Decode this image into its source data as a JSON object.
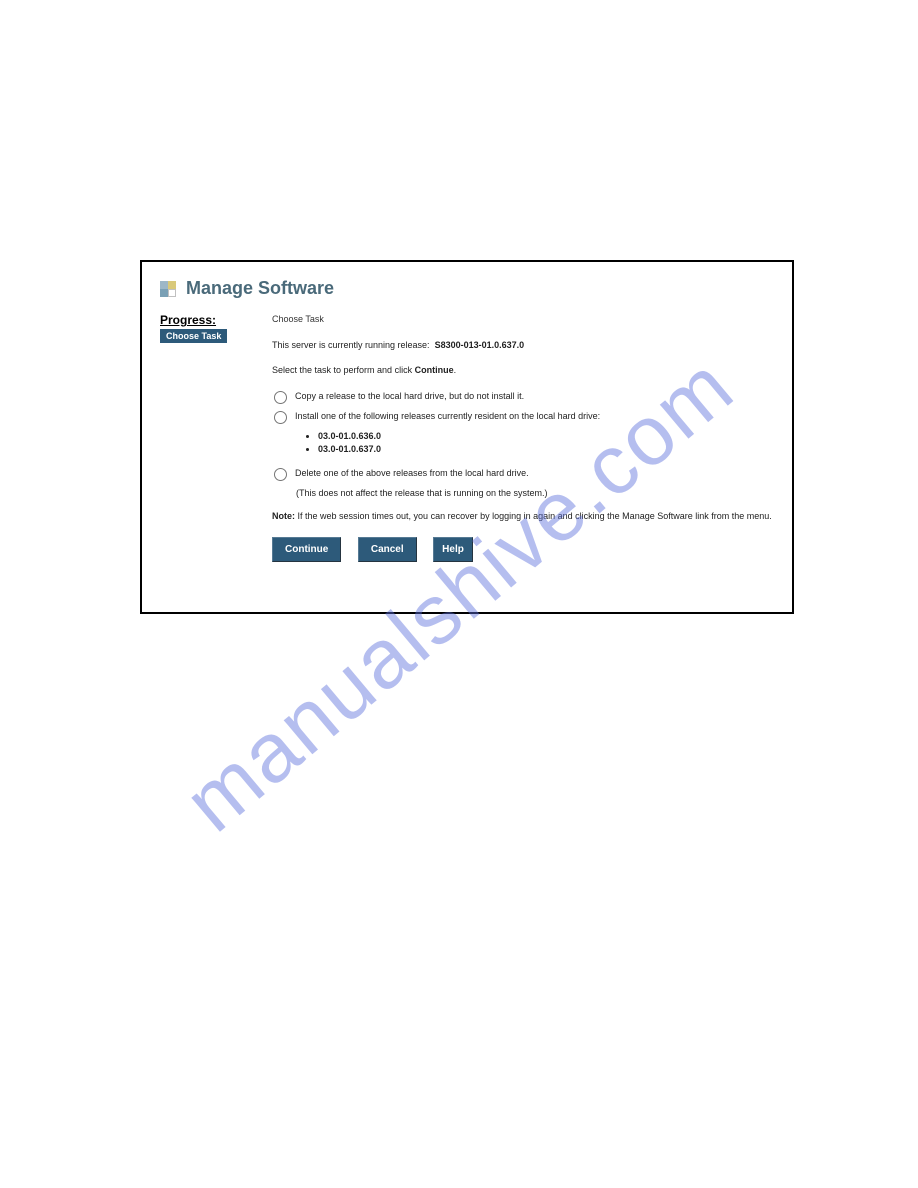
{
  "watermark": "manualshive.com",
  "header": {
    "title": "Manage Software"
  },
  "progress": {
    "label": "Progress:",
    "step": "Choose Task"
  },
  "main": {
    "step_title": "Choose Task",
    "running_prefix": "This server is currently running release:",
    "running_release": "S8300-013-01.0.637.0",
    "select_prefix": "Select the task to perform and click ",
    "select_bold": "Continue",
    "select_suffix": ".",
    "options": {
      "copy": "Copy a release to the local hard drive, but do not install it.",
      "install": "Install one of the following releases currently resident on the local hard drive:",
      "delete": "Delete one of the above releases from the local hard drive.",
      "delete_note": "(This does not affect the release that is running on the system.)"
    },
    "releases": [
      "03.0-01.0.636.0",
      "03.0-01.0.637.0"
    ],
    "note_bold": "Note:",
    "note_text": " If the web session times out, you can recover by logging in again and clicking the Manage Software link from the menu.",
    "buttons": {
      "continue": "Continue",
      "cancel": "Cancel",
      "help": "Help"
    }
  }
}
